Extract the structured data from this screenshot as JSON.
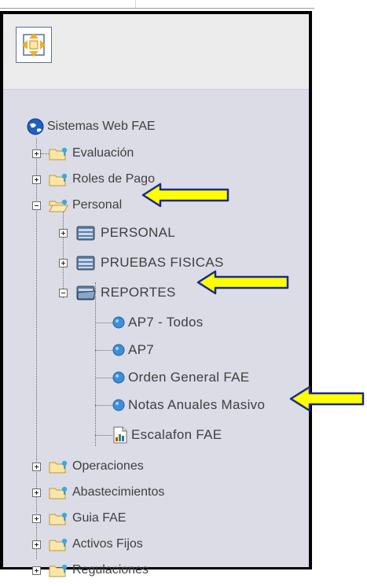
{
  "tree": {
    "root": {
      "label": "Sistemas Web FAE",
      "icon": "globe-icon"
    },
    "evaluacion": {
      "label": "Evaluación"
    },
    "roles_pago": {
      "label": "Roles de Pago"
    },
    "personal": {
      "label": "Personal",
      "children": {
        "personal_sub": {
          "label": "PERSONAL"
        },
        "pruebas": {
          "label": "PRUEBAS FISICAS"
        },
        "reportes": {
          "label": "REPORTES",
          "items": [
            "AP7 - Todos",
            "AP7",
            "Orden General FAE",
            "Notas Anuales Masivo",
            "Escalafon FAE"
          ]
        }
      }
    },
    "operaciones": {
      "label": "Operaciones"
    },
    "abastecimientos": {
      "label": "Abastecimientos"
    },
    "guia": {
      "label": "Guia FAE"
    },
    "activos": {
      "label": "Activos Fijos"
    },
    "regulaciones": {
      "label": "Regulaciones"
    }
  },
  "colors": {
    "arrow_fill": "#ffff00",
    "arrow_stroke": "#1a2a8c",
    "panel_bg": "#dcdce6"
  }
}
